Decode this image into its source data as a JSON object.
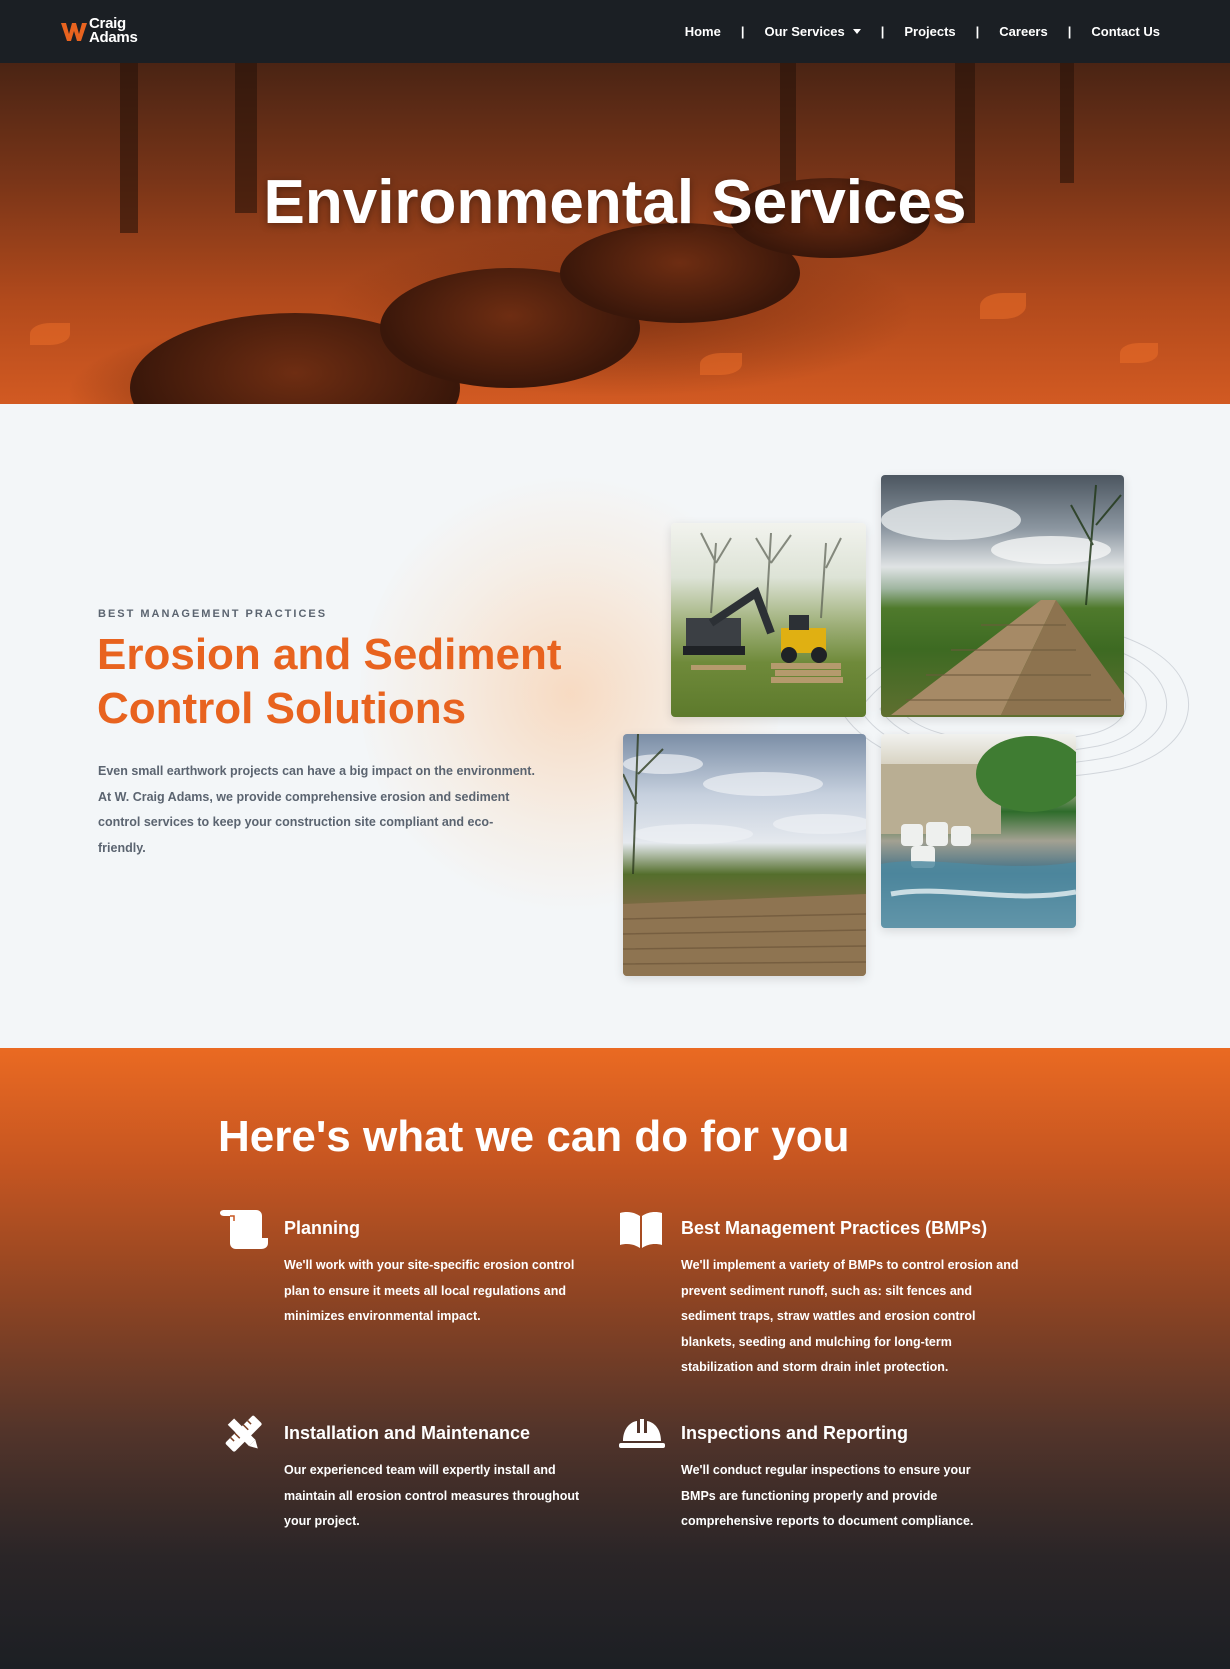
{
  "nav": {
    "logo": {
      "line1": "Craig",
      "line2": "Adams"
    },
    "items": [
      {
        "label": "Home"
      },
      {
        "label": "Our Services",
        "has_dropdown": true
      },
      {
        "label": "Projects"
      },
      {
        "label": "Careers"
      },
      {
        "label": "Contact Us"
      }
    ],
    "separator": "|"
  },
  "hero": {
    "title": "Environmental Services"
  },
  "intro": {
    "eyebrow": "BEST MANAGEMENT PRACTICES",
    "title": "Erosion and Sediment Control Solutions",
    "text": "Even small earthwork projects can have a big impact on the environment. At W. Craig Adams, we provide comprehensive erosion and sediment control services to keep your construction site compliant and eco-friendly."
  },
  "services": {
    "title": "Here's what we can do for you",
    "items": [
      {
        "icon": "scroll-icon",
        "title": "Planning",
        "text": "We'll work with your site-specific erosion control plan to ensure it meets all local regulations and minimizes environmental impact."
      },
      {
        "icon": "book-open-icon",
        "title": "Best Management Practices (BMPs)",
        "text": "We'll implement a variety of BMPs to control erosion and prevent sediment runoff, such as: silt fences and sediment traps, straw wattles and erosion control blankets, seeding and mulching for long-term stabilization and storm drain inlet protection."
      },
      {
        "icon": "pencil-ruler-icon",
        "title": "Installation and Maintenance",
        "text": "Our experienced team will expertly install and maintain all erosion control measures throughout your project."
      },
      {
        "icon": "hard-hat-icon",
        "title": "Inspections and Reporting",
        "text": "We'll conduct regular inspections to ensure your BMPs are functioning properly and provide comprehensive reports to document compliance."
      }
    ]
  },
  "colors": {
    "brand_orange": "#e8631f",
    "nav_bg": "#1b1f24",
    "text_gray": "#5b6470"
  }
}
